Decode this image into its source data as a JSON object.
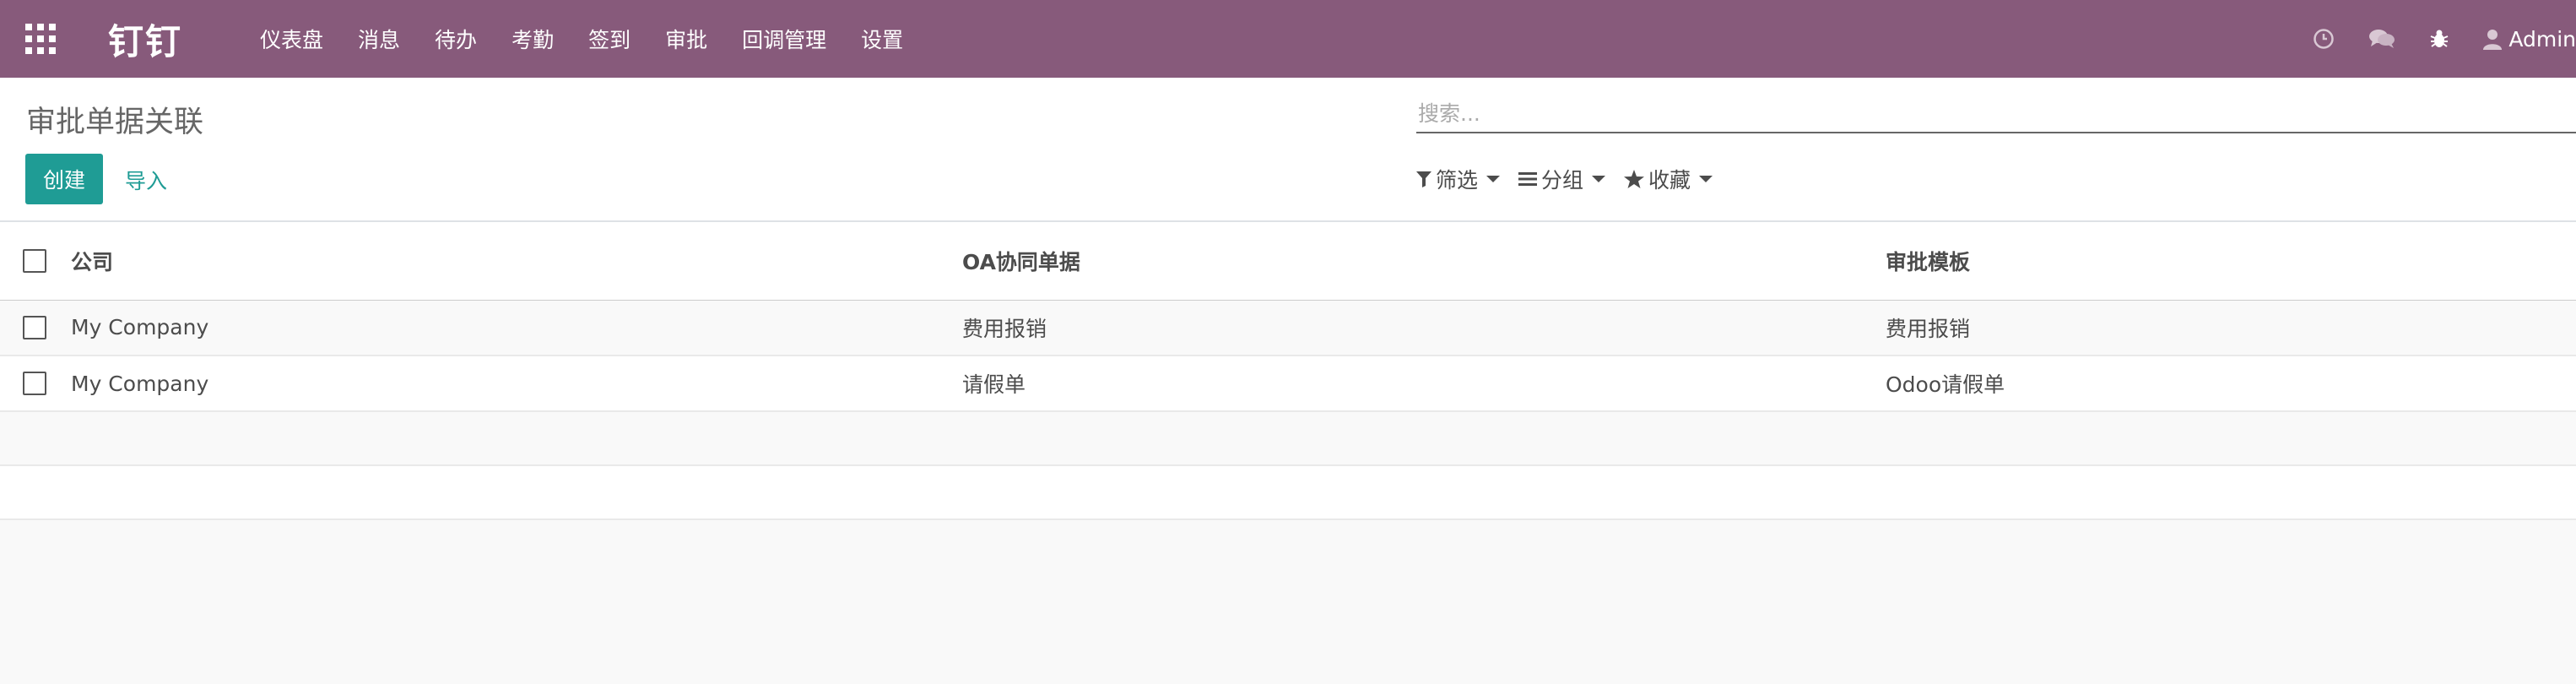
{
  "navbar": {
    "brand": "钉钉",
    "menu": [
      "仪表盘",
      "消息",
      "待办",
      "考勤",
      "签到",
      "审批",
      "回调管理",
      "设置"
    ],
    "user": "Admin",
    "bg_color": "#875a7b"
  },
  "control_panel": {
    "title": "审批单据关联",
    "create_label": "创建",
    "import_label": "导入",
    "search_placeholder": "搜索...",
    "filter_label": "筛选",
    "group_label": "分组",
    "favorite_label": "收藏"
  },
  "table": {
    "headers": {
      "company": "公司",
      "oa_document": "OA协同单据",
      "approval_template": "审批模板"
    },
    "rows": [
      {
        "company": "My Company",
        "oa_document": "费用报销",
        "approval_template": "费用报销"
      },
      {
        "company": "My Company",
        "oa_document": "请假单",
        "approval_template": "Odoo请假单"
      }
    ]
  },
  "colors": {
    "primary": "#1f9c95",
    "navbar": "#875a7b"
  }
}
